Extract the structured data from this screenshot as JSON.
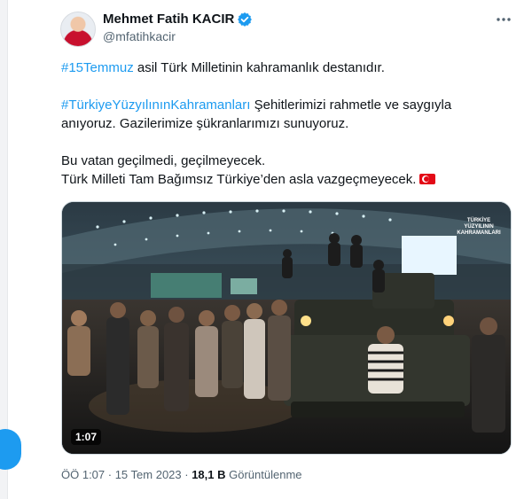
{
  "author": {
    "display_name": "Mehmet Fatih KACIR",
    "handle": "@mfatihkacir",
    "verified": true
  },
  "tweet": {
    "hashtag_1": "#15Temmuz",
    "line_1_rest": " asil Türk Milletinin kahramanlık destanıdır.",
    "hashtag_2": "#TürkiyeYüzyılınınKahramanları",
    "line_2_rest": " Şehitlerimizi rahmetle ve saygıyla anıyoruz. Gazilerimize şükranlarımızı sunuyoruz.",
    "line_3": "Bu vatan geçilmedi, geçilmeyecek.",
    "line_4": "Türk Milleti Tam Bağımsız Türkiye’den asla vazgeçmeyecek.",
    "flag_icon": "turkey-flag"
  },
  "video": {
    "duration": "1:07",
    "watermark": "TÜRKİYE YÜZYILININ KAHRAMANLARI"
  },
  "meta": {
    "time": "ÖÖ 1:07",
    "separator_1": " · ",
    "date": "15 Tem 2023",
    "separator_2": " · ",
    "views_count": "18,1 B",
    "views_label": " Görüntülenme"
  },
  "colors": {
    "accent": "#1d9bf0",
    "text": "#0f1419",
    "muted": "#536471"
  }
}
